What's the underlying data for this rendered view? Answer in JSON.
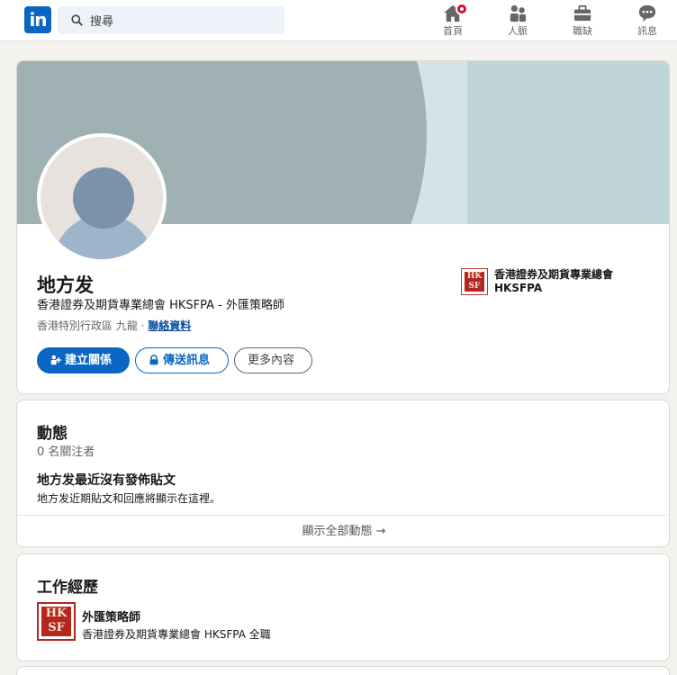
{
  "nav": {
    "logo_text": "in",
    "search_placeholder": "搜尋",
    "items": [
      {
        "label": "首頁",
        "icon": "home-icon"
      },
      {
        "label": "人脈",
        "icon": "people-icon"
      },
      {
        "label": "職缺",
        "icon": "briefcase-icon"
      },
      {
        "label": "訊息",
        "icon": "message-icon"
      }
    ]
  },
  "profile": {
    "name": "地方发",
    "headline": "香港證券及期貨專業總會 HKSFPA - 外匯策略師",
    "location": "香港特別行政區 九龍 · ",
    "contact_link": "聯絡資料",
    "buttons": {
      "connect": "建立關係",
      "message": "傳送訊息",
      "more": "更多內容"
    },
    "org": {
      "name": "香港證券及期貨專業總會 HKSFPA",
      "logo_text": "HKSFPA"
    }
  },
  "activity": {
    "title": "動態",
    "followers": "0 名關注者",
    "empty_title": "地方发最近沒有發佈貼文",
    "empty_sub": "地方发近期貼文和回應將顯示在這裡。",
    "show_all": "顯示全部動態 →"
  },
  "experience": {
    "title": "工作經歷",
    "role": "外匯策略師",
    "org_line": "香港證券及期貨專業總會 HKSFPA 全職"
  },
  "colors": {
    "brand_blue": "#0a66c2",
    "badge_red": "#cb112d"
  }
}
